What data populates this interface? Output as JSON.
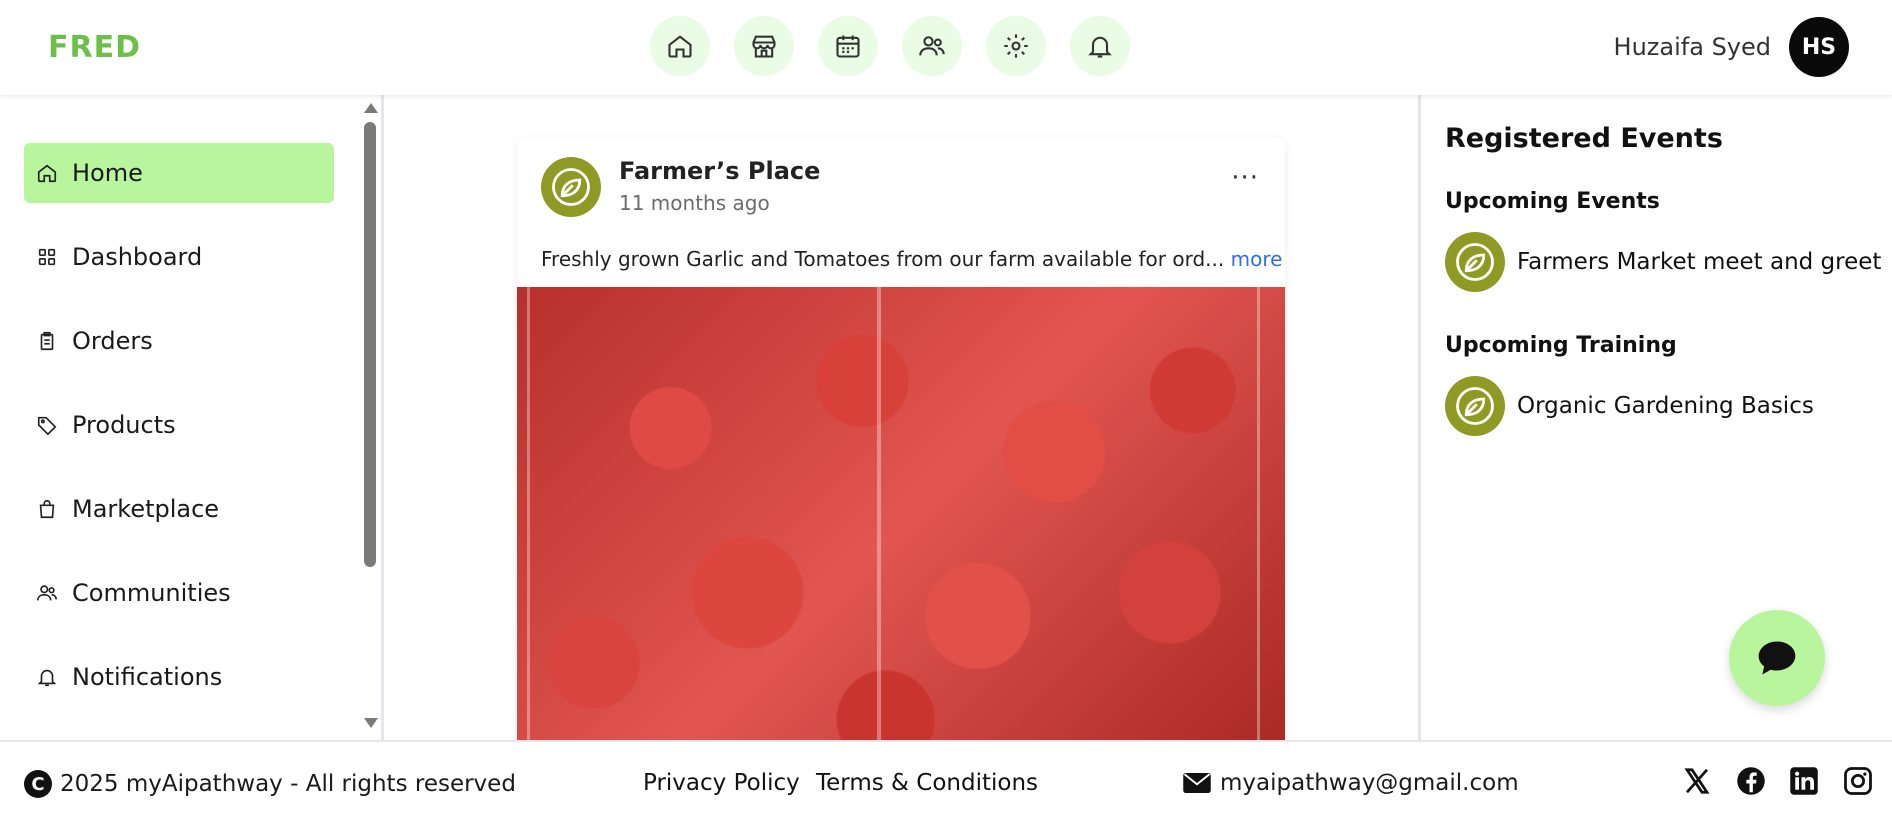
{
  "header": {
    "logo": "FRED",
    "nav_icons": [
      "home-icon",
      "store-icon",
      "calendar-icon",
      "users-icon",
      "settings-icon",
      "bell-icon"
    ],
    "user_name": "Huzaifa Syed",
    "avatar_initials": "HS"
  },
  "sidebar": {
    "items": [
      {
        "label": "Home",
        "icon": "home-icon",
        "active": true
      },
      {
        "label": "Dashboard",
        "icon": "grid-icon",
        "active": false
      },
      {
        "label": "Orders",
        "icon": "clipboard-icon",
        "active": false
      },
      {
        "label": "Products",
        "icon": "tag-icon",
        "active": false
      },
      {
        "label": "Marketplace",
        "icon": "bag-icon",
        "active": false
      },
      {
        "label": "Communities",
        "icon": "users-icon",
        "active": false
      },
      {
        "label": "Notifications",
        "icon": "bell-icon",
        "active": false
      }
    ]
  },
  "post": {
    "author": "Farmer’s Place",
    "time": "11 months ago",
    "text": "Freshly grown Garlic and Tomatoes from our farm available for ord...",
    "more": "more",
    "menu": "···"
  },
  "right_panel": {
    "title": "Registered Events",
    "events_heading": "Upcoming Events",
    "event": "Farmers Market meet and greet",
    "training_heading": "Upcoming Training",
    "training": "Organic Gardening Basics"
  },
  "footer": {
    "copyright": "2025 myAipathway - All rights reserved",
    "privacy": "Privacy Policy",
    "terms": "Terms & Conditions",
    "email": "myaipathway@gmail.com"
  },
  "colors": {
    "brand_green": "#6cc04a",
    "active_bg": "#b9f59c",
    "nav_icon_bg": "#eafbe6",
    "olive_logo": "#8f9a25",
    "link_blue": "#2f6ee8"
  }
}
